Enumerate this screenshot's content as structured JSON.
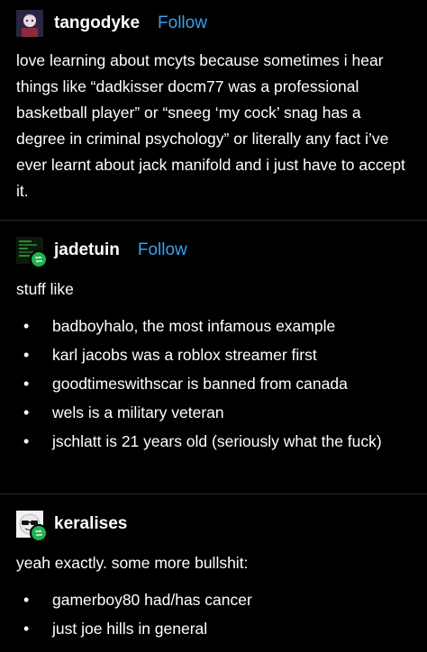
{
  "posts": [
    {
      "username": "tangodyke",
      "follow_label": "Follow",
      "text": "love learning about mcyts because sometimes i hear things like “dadkisser docm77 was a professional basketball player” or “sneeg ‘my cock’ snag has a degree in criminal psychology” or literally any fact i’ve ever learnt about jack manifold and i just have to accept it."
    },
    {
      "username": "jadetuin",
      "follow_label": "Follow",
      "text": "stuff like",
      "bullets": [
        "badboyhalo, the most infamous example",
        "karl jacobs was a roblox streamer first",
        "goodtimeswithscar is banned from canada",
        "wels is a military veteran",
        "jschlatt is 21 years old (seriously what the fuck)"
      ]
    },
    {
      "username": "keralises",
      "text": "yeah exactly. some more bullshit:",
      "bullets": [
        "gamerboy80 had/has cancer",
        "just joe hills in general"
      ]
    }
  ],
  "icons": {
    "reblog": "reblog-icon",
    "bullet": "•"
  },
  "colors": {
    "background": "#000000",
    "text": "#ffffff",
    "follow": "#3aa0ea",
    "reblog_badge": "#21b24e"
  }
}
